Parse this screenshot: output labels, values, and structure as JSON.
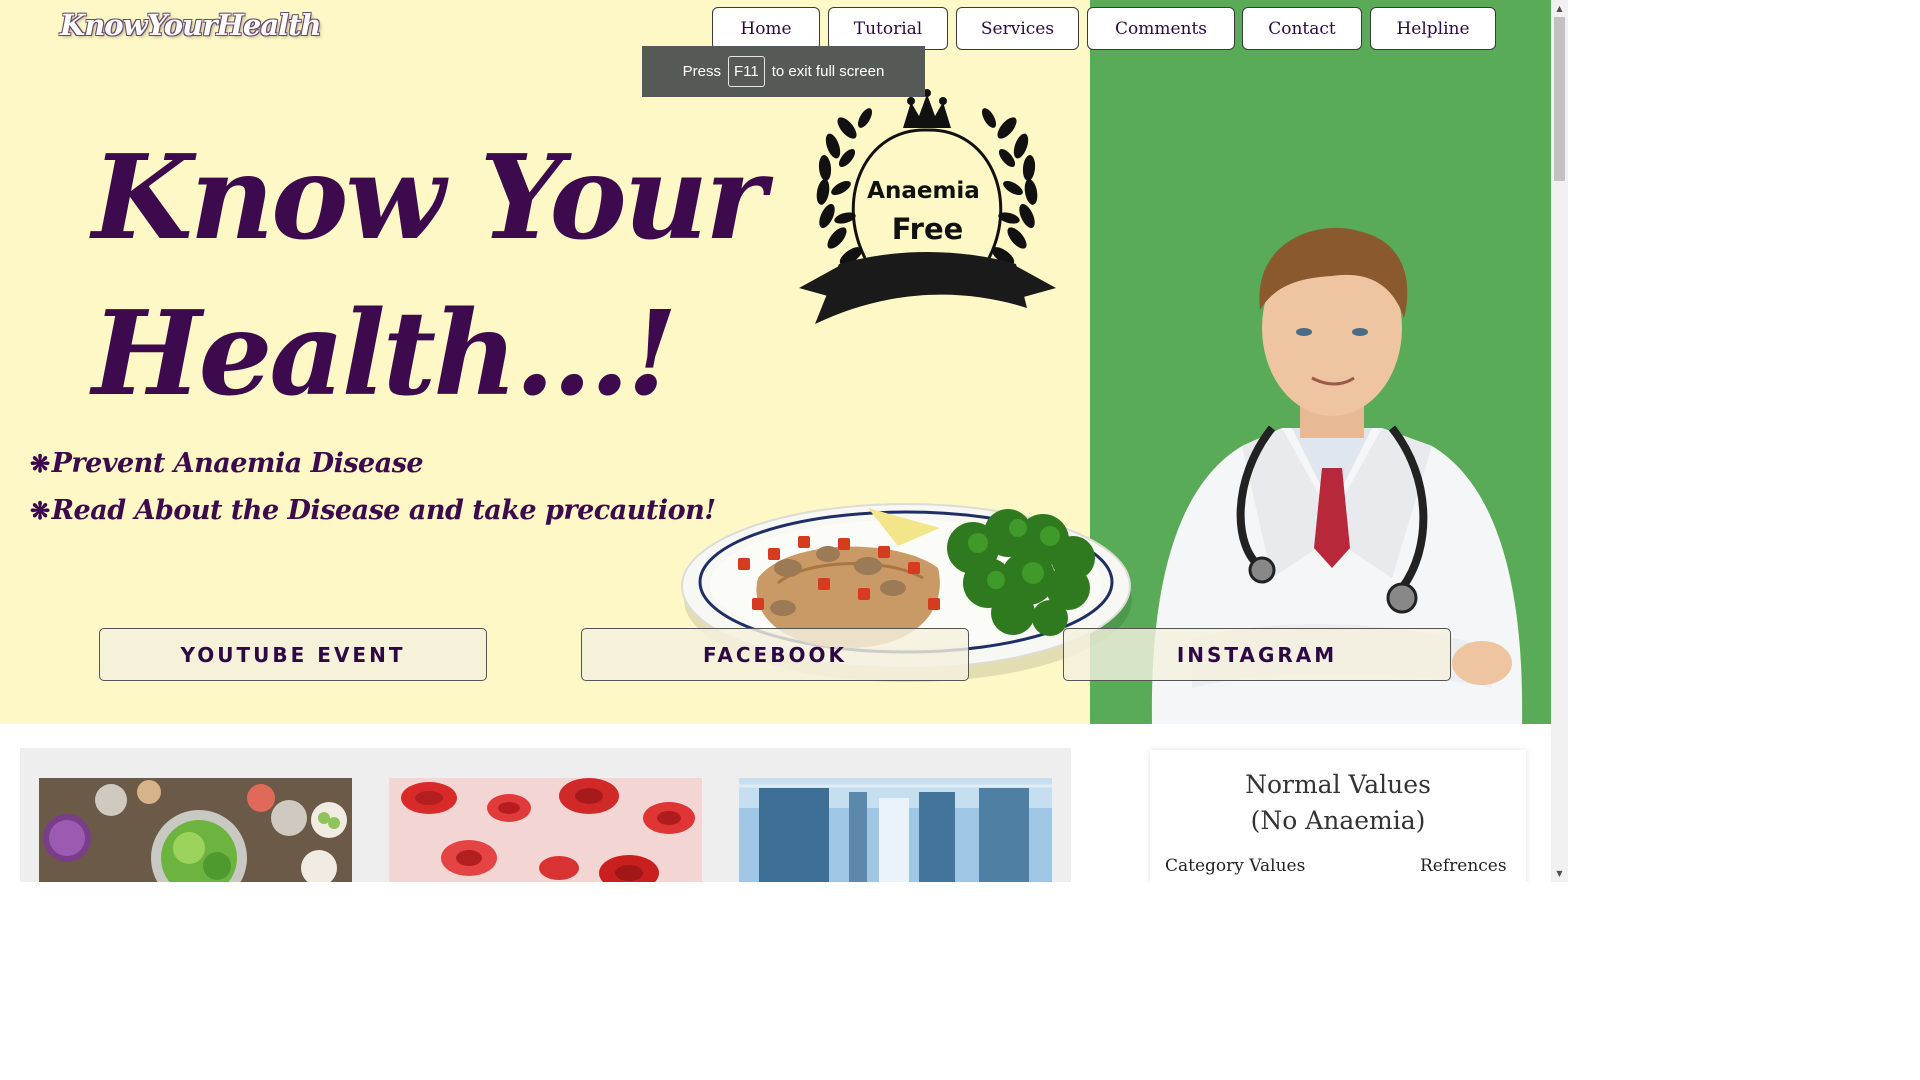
{
  "header": {
    "logo_text": "KnowYourHealth"
  },
  "nav": {
    "items": [
      {
        "label": "Home"
      },
      {
        "label": "Tutorial"
      },
      {
        "label": "Services"
      },
      {
        "label": "Comments"
      },
      {
        "label": "Contact"
      },
      {
        "label": "Helpline"
      }
    ]
  },
  "fullscreen_notice": {
    "prefix": "Press",
    "key": "F11",
    "suffix": "to exit full screen"
  },
  "hero": {
    "title_line1": "Know Your",
    "title_line2": "Health...!",
    "bullets": [
      {
        "star": "❋",
        "text": "Prevent Anaemia Disease"
      },
      {
        "star": "❋",
        "text": "Read About the Disease and take precaution!"
      }
    ],
    "badge": {
      "line1": "Anaemia",
      "line2": "Free"
    }
  },
  "social": {
    "youtube": "YOUTUBE EVENT",
    "facebook": "FACEBOOK",
    "instagram": "INSTAGRAM"
  },
  "normal_values": {
    "title_line1": "Normal Values",
    "title_line2": "(No Anaemia)",
    "col_category": "Category Values",
    "col_refs": "Refrences"
  },
  "colors": {
    "hero_bg": "#fdf8c6",
    "green_panel": "#59ab58",
    "title_purple": "#3d0a4d"
  },
  "icons": {
    "laurel": "laurel-wreath-crown-icon",
    "scroll_up": "scroll-up-arrow-icon",
    "scroll_down": "scroll-down-arrow-icon"
  }
}
